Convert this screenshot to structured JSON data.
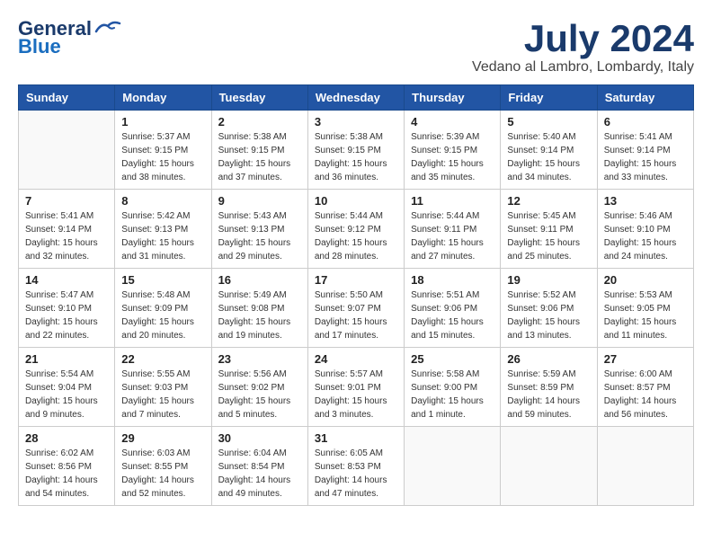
{
  "header": {
    "logo_line1": "General",
    "logo_line2": "Blue",
    "month_title": "July 2024",
    "location": "Vedano al Lambro, Lombardy, Italy"
  },
  "days_of_week": [
    "Sunday",
    "Monday",
    "Tuesday",
    "Wednesday",
    "Thursday",
    "Friday",
    "Saturday"
  ],
  "weeks": [
    [
      {
        "day": "",
        "info": ""
      },
      {
        "day": "1",
        "info": "Sunrise: 5:37 AM\nSunset: 9:15 PM\nDaylight: 15 hours\nand 38 minutes."
      },
      {
        "day": "2",
        "info": "Sunrise: 5:38 AM\nSunset: 9:15 PM\nDaylight: 15 hours\nand 37 minutes."
      },
      {
        "day": "3",
        "info": "Sunrise: 5:38 AM\nSunset: 9:15 PM\nDaylight: 15 hours\nand 36 minutes."
      },
      {
        "day": "4",
        "info": "Sunrise: 5:39 AM\nSunset: 9:15 PM\nDaylight: 15 hours\nand 35 minutes."
      },
      {
        "day": "5",
        "info": "Sunrise: 5:40 AM\nSunset: 9:14 PM\nDaylight: 15 hours\nand 34 minutes."
      },
      {
        "day": "6",
        "info": "Sunrise: 5:41 AM\nSunset: 9:14 PM\nDaylight: 15 hours\nand 33 minutes."
      }
    ],
    [
      {
        "day": "7",
        "info": "Sunrise: 5:41 AM\nSunset: 9:14 PM\nDaylight: 15 hours\nand 32 minutes."
      },
      {
        "day": "8",
        "info": "Sunrise: 5:42 AM\nSunset: 9:13 PM\nDaylight: 15 hours\nand 31 minutes."
      },
      {
        "day": "9",
        "info": "Sunrise: 5:43 AM\nSunset: 9:13 PM\nDaylight: 15 hours\nand 29 minutes."
      },
      {
        "day": "10",
        "info": "Sunrise: 5:44 AM\nSunset: 9:12 PM\nDaylight: 15 hours\nand 28 minutes."
      },
      {
        "day": "11",
        "info": "Sunrise: 5:44 AM\nSunset: 9:11 PM\nDaylight: 15 hours\nand 27 minutes."
      },
      {
        "day": "12",
        "info": "Sunrise: 5:45 AM\nSunset: 9:11 PM\nDaylight: 15 hours\nand 25 minutes."
      },
      {
        "day": "13",
        "info": "Sunrise: 5:46 AM\nSunset: 9:10 PM\nDaylight: 15 hours\nand 24 minutes."
      }
    ],
    [
      {
        "day": "14",
        "info": "Sunrise: 5:47 AM\nSunset: 9:10 PM\nDaylight: 15 hours\nand 22 minutes."
      },
      {
        "day": "15",
        "info": "Sunrise: 5:48 AM\nSunset: 9:09 PM\nDaylight: 15 hours\nand 20 minutes."
      },
      {
        "day": "16",
        "info": "Sunrise: 5:49 AM\nSunset: 9:08 PM\nDaylight: 15 hours\nand 19 minutes."
      },
      {
        "day": "17",
        "info": "Sunrise: 5:50 AM\nSunset: 9:07 PM\nDaylight: 15 hours\nand 17 minutes."
      },
      {
        "day": "18",
        "info": "Sunrise: 5:51 AM\nSunset: 9:06 PM\nDaylight: 15 hours\nand 15 minutes."
      },
      {
        "day": "19",
        "info": "Sunrise: 5:52 AM\nSunset: 9:06 PM\nDaylight: 15 hours\nand 13 minutes."
      },
      {
        "day": "20",
        "info": "Sunrise: 5:53 AM\nSunset: 9:05 PM\nDaylight: 15 hours\nand 11 minutes."
      }
    ],
    [
      {
        "day": "21",
        "info": "Sunrise: 5:54 AM\nSunset: 9:04 PM\nDaylight: 15 hours\nand 9 minutes."
      },
      {
        "day": "22",
        "info": "Sunrise: 5:55 AM\nSunset: 9:03 PM\nDaylight: 15 hours\nand 7 minutes."
      },
      {
        "day": "23",
        "info": "Sunrise: 5:56 AM\nSunset: 9:02 PM\nDaylight: 15 hours\nand 5 minutes."
      },
      {
        "day": "24",
        "info": "Sunrise: 5:57 AM\nSunset: 9:01 PM\nDaylight: 15 hours\nand 3 minutes."
      },
      {
        "day": "25",
        "info": "Sunrise: 5:58 AM\nSunset: 9:00 PM\nDaylight: 15 hours\nand 1 minute."
      },
      {
        "day": "26",
        "info": "Sunrise: 5:59 AM\nSunset: 8:59 PM\nDaylight: 14 hours\nand 59 minutes."
      },
      {
        "day": "27",
        "info": "Sunrise: 6:00 AM\nSunset: 8:57 PM\nDaylight: 14 hours\nand 56 minutes."
      }
    ],
    [
      {
        "day": "28",
        "info": "Sunrise: 6:02 AM\nSunset: 8:56 PM\nDaylight: 14 hours\nand 54 minutes."
      },
      {
        "day": "29",
        "info": "Sunrise: 6:03 AM\nSunset: 8:55 PM\nDaylight: 14 hours\nand 52 minutes."
      },
      {
        "day": "30",
        "info": "Sunrise: 6:04 AM\nSunset: 8:54 PM\nDaylight: 14 hours\nand 49 minutes."
      },
      {
        "day": "31",
        "info": "Sunrise: 6:05 AM\nSunset: 8:53 PM\nDaylight: 14 hours\nand 47 minutes."
      },
      {
        "day": "",
        "info": ""
      },
      {
        "day": "",
        "info": ""
      },
      {
        "day": "",
        "info": ""
      }
    ]
  ]
}
